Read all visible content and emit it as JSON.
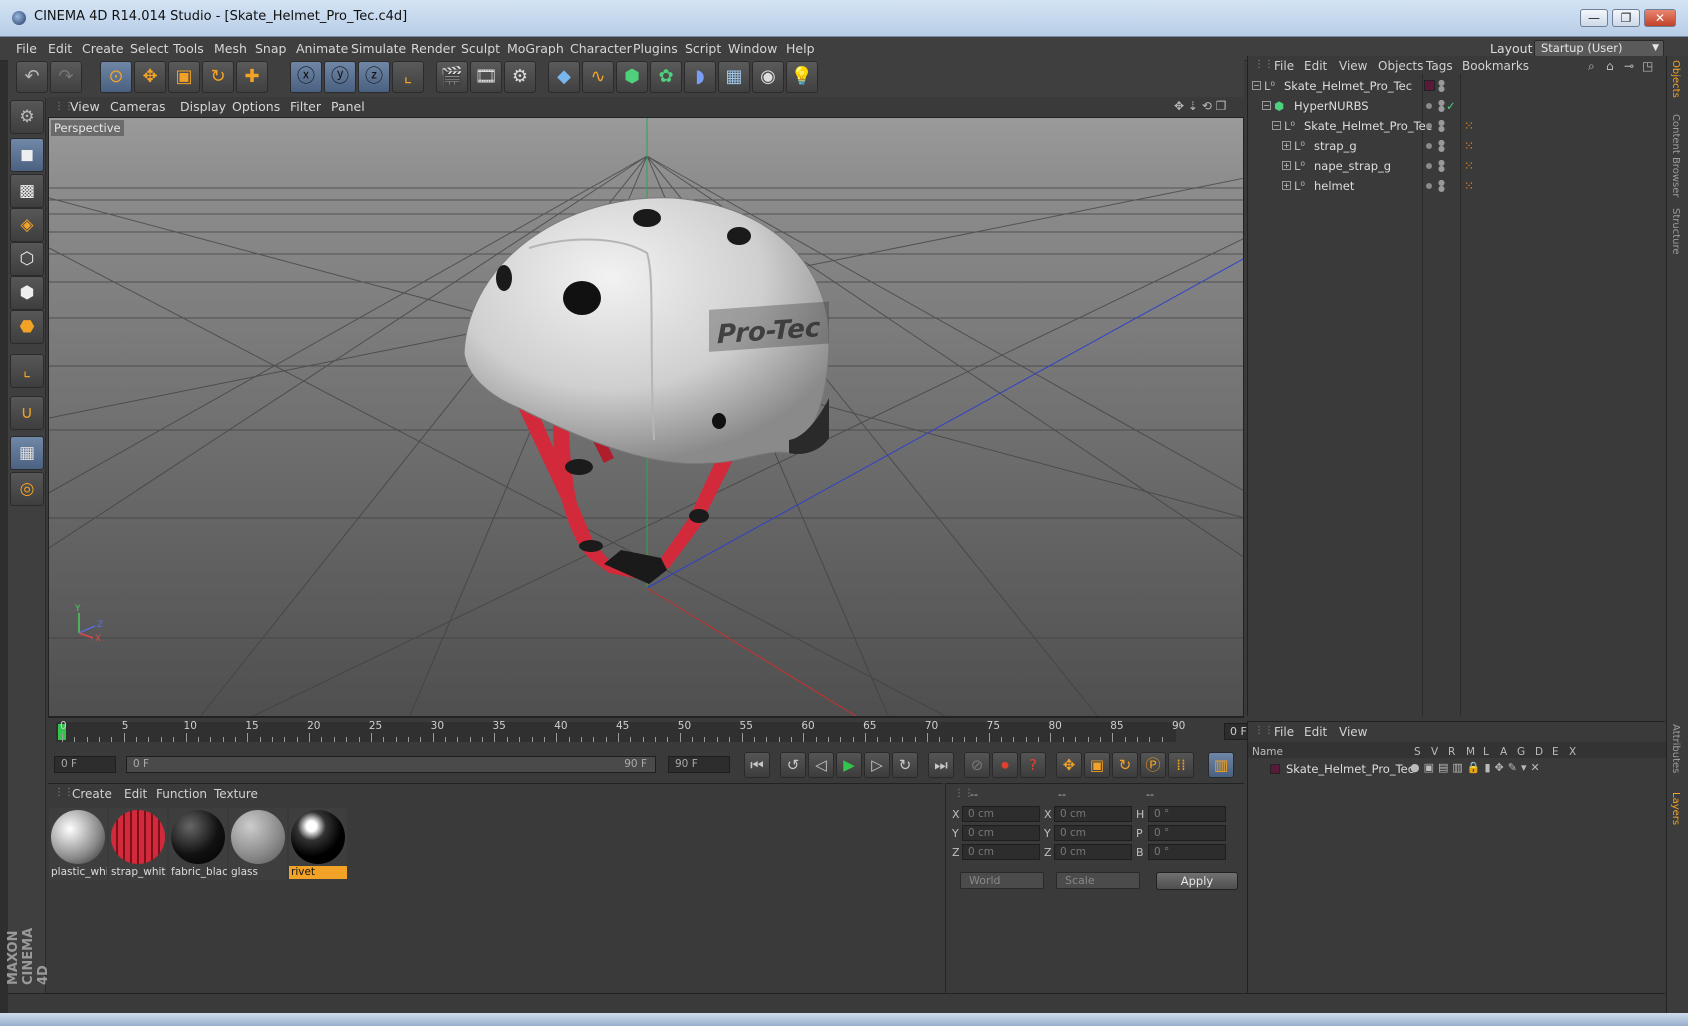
{
  "window": {
    "title": "CINEMA 4D R14.014 Studio - [Skate_Helmet_Pro_Tec.c4d]",
    "min": "—",
    "restore": "❐",
    "close": "✕"
  },
  "menubar": {
    "items": [
      "File",
      "Edit",
      "Create",
      "Select",
      "Tools",
      "Mesh",
      "Snap",
      "Animate",
      "Simulate",
      "Render",
      "Sculpt",
      "MoGraph",
      "Character",
      "Plugins",
      "Script",
      "Window",
      "Help"
    ],
    "layout_label": "Layout:",
    "layout_value": "Startup (User)"
  },
  "viewport": {
    "menu": [
      "View",
      "Cameras",
      "Display",
      "Options",
      "Filter",
      "Panel"
    ],
    "camera_label": "Perspective",
    "decal_text": "Pro-Tec",
    "axis_labels": {
      "y": "Y",
      "z": "Z",
      "x": "X"
    }
  },
  "timeline": {
    "ticks": [
      "0",
      "5",
      "10",
      "15",
      "20",
      "25",
      "30",
      "35",
      "40",
      "45",
      "50",
      "55",
      "60",
      "65",
      "70",
      "75",
      "80",
      "85",
      "90"
    ],
    "current_frame": "0 F",
    "start_field": "0 F",
    "range_start": "0 F",
    "range_end": "90 F",
    "end_field": "90 F"
  },
  "materials": {
    "menu": [
      "Create",
      "Edit",
      "Function",
      "Texture"
    ],
    "items": [
      {
        "name": "plastic_whi",
        "color": "#d8d8d8"
      },
      {
        "name": "strap_whit",
        "color": "#c9202e"
      },
      {
        "name": "fabric_blac",
        "color": "#1a1a1a"
      },
      {
        "name": "glass",
        "color": "#9a9a9a"
      },
      {
        "name": "rivet",
        "color": "#0d0d0d",
        "selected": true
      }
    ]
  },
  "coords": {
    "headers": [
      "--",
      "--",
      "--"
    ],
    "rows": [
      {
        "a": "X",
        "av": "0 cm",
        "b": "X",
        "bv": "0 cm",
        "c": "H",
        "cv": "0 °"
      },
      {
        "a": "Y",
        "av": "0 cm",
        "b": "Y",
        "bv": "0 cm",
        "c": "P",
        "cv": "0 °"
      },
      {
        "a": "Z",
        "av": "0 cm",
        "b": "Z",
        "bv": "0 cm",
        "c": "B",
        "cv": "0 °"
      }
    ],
    "space": "World",
    "mode": "Scale",
    "apply": "Apply"
  },
  "objects": {
    "menu": [
      "File",
      "Edit",
      "View",
      "Objects",
      "Tags",
      "Bookmarks"
    ],
    "tree": [
      {
        "name": "Skate_Helmet_Pro_Tec",
        "depth": 0,
        "icon": "null"
      },
      {
        "name": "HyperNURBS",
        "depth": 1,
        "icon": "hypernurbs"
      },
      {
        "name": "Skate_Helmet_Pro_Tec",
        "depth": 2,
        "icon": "null"
      },
      {
        "name": "strap_g",
        "depth": 3,
        "icon": "null"
      },
      {
        "name": "nape_strap_g",
        "depth": 3,
        "icon": "null"
      },
      {
        "name": "helmet",
        "depth": 3,
        "icon": "null"
      }
    ]
  },
  "layers": {
    "menu": [
      "File",
      "Edit",
      "View"
    ],
    "columns": [
      "Name",
      "S",
      "V",
      "R",
      "M",
      "L",
      "A",
      "G",
      "D",
      "E",
      "X"
    ],
    "rows": [
      {
        "name": "Skate_Helmet_Pro_Tec",
        "color": "#5a1a3a"
      }
    ]
  },
  "side_tabs": [
    "Objects",
    "Content Browser",
    "Structure",
    "Attributes",
    "Layers"
  ],
  "brand": "MAXON CINEMA 4D",
  "colors": {
    "accent": "#f2a226",
    "select_blue": "#5b7396",
    "strap_red": "#d22a3a"
  }
}
